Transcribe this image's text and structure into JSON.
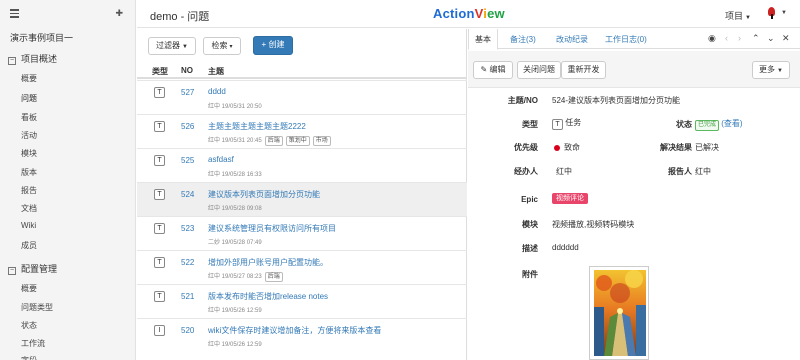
{
  "app": {
    "logo": [
      "Action",
      "V",
      "i",
      "ew"
    ],
    "page_title": "demo - 问题",
    "project_menu": "项目"
  },
  "sidebar": {
    "project_name": "演示事例项目一",
    "groups": [
      {
        "label": "项目概述",
        "toggle": "⊟",
        "items": [
          "概要",
          "问题",
          "看板",
          "活动",
          "模块",
          "版本",
          "报告",
          "文档",
          "Wiki",
          "成员"
        ]
      },
      {
        "label": "配置管理",
        "toggle": "⊟",
        "items": [
          "概要",
          "问题类型",
          "状态",
          "工作流",
          "字段"
        ]
      }
    ]
  },
  "toolbar": {
    "filter": "过滤器",
    "search": "检索",
    "create": "+ 创建"
  },
  "list": {
    "columns": {
      "type": "类型",
      "no": "NO",
      "title": "主题"
    },
    "rows": [
      {
        "type": "T",
        "no": "527",
        "title": "dddd",
        "meta": "红中  19/05/31 20:50",
        "labels": []
      },
      {
        "type": "T",
        "no": "526",
        "title": "主题主题主题主题主题2222",
        "meta": "红中  19/05/31 20:45",
        "labels": [
          "后端",
          "策划中",
          "市场"
        ]
      },
      {
        "type": "T",
        "no": "525",
        "title": "asfdasf",
        "meta": "红中  19/05/28 16:33",
        "labels": []
      },
      {
        "type": "T",
        "no": "524",
        "title": "建议版本列表页面增加分页功能",
        "meta": "红中  19/05/28 09:08",
        "labels": []
      },
      {
        "type": "T",
        "no": "523",
        "title": "建议系统管理员有权限访问所有项目",
        "meta": "二妙  19/05/28 07:49",
        "labels": []
      },
      {
        "type": "T",
        "no": "522",
        "title": "增加外部用户账号用户配置功能。",
        "meta": "红中  19/05/27 08:23",
        "labels": [
          "后端"
        ]
      },
      {
        "type": "T",
        "no": "521",
        "title": "版本发布时能否增加release notes",
        "meta": "红中  19/05/26 12:59",
        "labels": []
      },
      {
        "type": "I",
        "no": "520",
        "title": "wiki文件保存时建议增加备注，方便将来版本查看",
        "meta": "红中  19/05/26 12:59",
        "labels": []
      }
    ]
  },
  "detail": {
    "tabs": [
      "基本",
      "备注(3)",
      "改动纪录",
      "工作日志(0)"
    ],
    "actions": {
      "edit": "编辑",
      "close": "关闭问题",
      "reopen": "重新开发",
      "more": "更多"
    },
    "fields": {
      "subject_label": "主题/NO",
      "subject_value": "524-建议版本列表页面增加分页功能",
      "type_label": "类型",
      "type_badge": "T",
      "type_value": "任务",
      "status_label": "状态",
      "status_value": "已完成",
      "status_link": "(查看)",
      "priority_label": "优先级",
      "priority_value": "致命",
      "resolution_label": "解决结果",
      "resolution_value": "已解决",
      "assignee_label": "经办人",
      "assignee_value": "红中",
      "reporter_label": "报告人",
      "reporter_value": "红中",
      "epic_label": "Epic",
      "epic_value": "视频评论",
      "module_label": "模块",
      "module_value": "视频播放,视频转码模块",
      "desc_label": "描述",
      "desc_value": "dddddd",
      "attach_label": "附件"
    }
  },
  "colors": {
    "primary": "#337ab7",
    "epic": "#e9446a",
    "priority": "#d9001b",
    "status_done": "#5cb85c"
  }
}
